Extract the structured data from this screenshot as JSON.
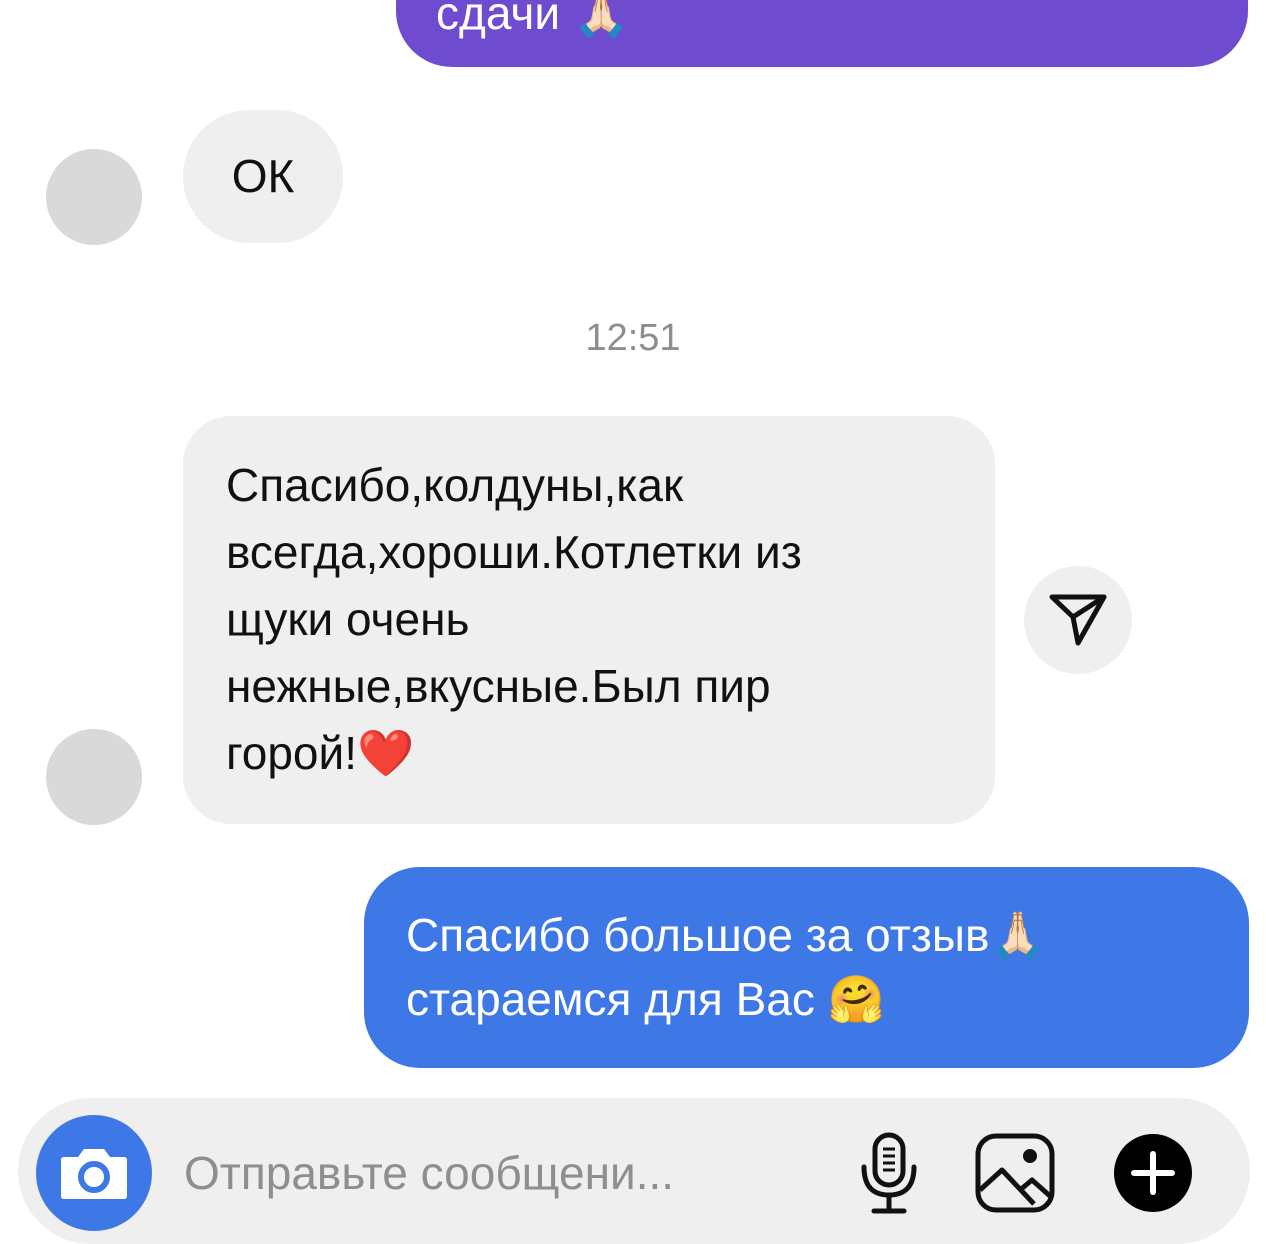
{
  "messages": {
    "outgoing_top": {
      "text": "сдачи 🙏🏻"
    },
    "incoming_ok": {
      "text": "ОК"
    },
    "timestamp": "12:51",
    "incoming_review": {
      "lines": [
        "Спасибо,колдуны,как",
        "всегда,хороши.Котлетки из",
        "щуки очень",
        "нежные,вкусные.Был пир",
        "горой!❤️"
      ]
    },
    "outgoing_reply": {
      "lines": [
        "Спасибо большое за отзыв🙏🏻",
        "стараемся для Вас 🤗"
      ]
    }
  },
  "composer": {
    "placeholder": "Отправьте сообщени..."
  },
  "icons": {
    "share": "paper-plane-icon",
    "camera": "camera-icon",
    "mic": "microphone-icon",
    "gallery": "image-icon",
    "add": "plus-circle-icon"
  },
  "colors": {
    "outgoing_purple": "#6f4bd0",
    "outgoing_blue": "#3e78e6",
    "incoming_gray": "#efefef",
    "avatar_gray": "#d9d9d9",
    "timestamp_gray": "#8e8e8e"
  }
}
